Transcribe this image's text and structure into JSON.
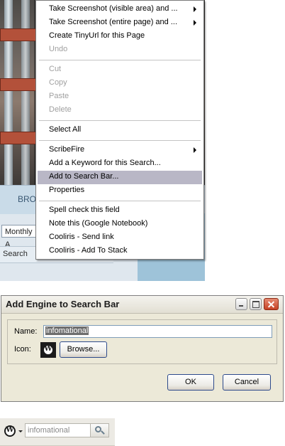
{
  "page_behind": {
    "nav_text": "BRO",
    "month_select": "Monthly A",
    "search_label": "Search"
  },
  "context_menu": {
    "items": [
      {
        "label": "Take Screenshot (visible area) and ...",
        "submenu": true,
        "disabled": false
      },
      {
        "label": "Take Screenshot (entire page) and ...",
        "submenu": true,
        "disabled": false
      },
      {
        "label": "Create TinyUrl for this Page",
        "submenu": false,
        "disabled": false
      },
      {
        "label": "Undo",
        "submenu": false,
        "disabled": true
      },
      {
        "label": "Cut",
        "submenu": false,
        "disabled": true
      },
      {
        "label": "Copy",
        "submenu": false,
        "disabled": true
      },
      {
        "label": "Paste",
        "submenu": false,
        "disabled": true
      },
      {
        "label": "Delete",
        "submenu": false,
        "disabled": true
      },
      {
        "label": "Select All",
        "submenu": false,
        "disabled": false
      },
      {
        "label": "ScribeFire",
        "submenu": true,
        "disabled": false
      },
      {
        "label": "Add a Keyword for this Search...",
        "submenu": false,
        "disabled": false
      },
      {
        "label": "Add to Search Bar...",
        "submenu": false,
        "disabled": false,
        "highlighted": true
      },
      {
        "label": "Properties",
        "submenu": false,
        "disabled": false
      },
      {
        "label": "Spell check this field",
        "submenu": false,
        "disabled": false
      },
      {
        "label": "Note this (Google Notebook)",
        "submenu": false,
        "disabled": false
      },
      {
        "label": "Cooliris - Send link",
        "submenu": false,
        "disabled": false
      },
      {
        "label": "Cooliris - Add To Stack",
        "submenu": false,
        "disabled": false
      }
    ]
  },
  "dialog": {
    "title": "Add Engine to Search Bar",
    "name_label": "Name:",
    "name_value": "infomational",
    "icon_label": "Icon:",
    "icon_name": "wordpress-icon",
    "browse_label": "Browse...",
    "ok_label": "OK",
    "cancel_label": "Cancel"
  },
  "search_bar": {
    "engine_icon": "wordpress-icon",
    "value": "infomational"
  },
  "colors": {
    "menu_highlight": "#b9b7c6",
    "dialog_face": "#ece9d8",
    "close_button": "#c64224"
  }
}
